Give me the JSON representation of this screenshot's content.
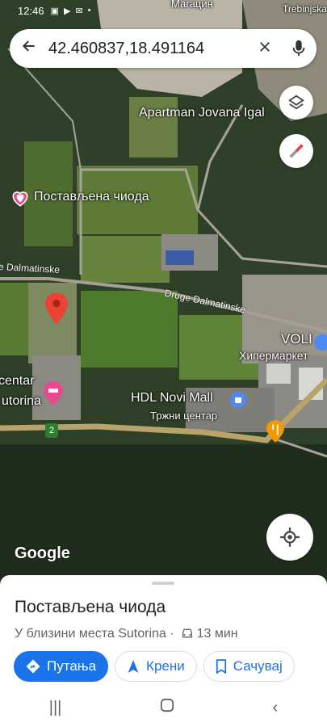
{
  "status_bar": {
    "time": "12:46"
  },
  "search": {
    "query": "42.460837,18.491164"
  },
  "map": {
    "labels": {
      "magacin": "Магацин",
      "trebinjska": "Trebinjska",
      "apartman": "Apartman Jovana Igal",
      "pin_label": "Постављена чиода",
      "road_druge_left": "e Dalmatinske",
      "road_druge_right": "Druge Dalmatinske",
      "voli": "VOLI",
      "voli_sub": "Хипермаркет",
      "hdl": "HDL Novi Mall",
      "hdl_sub": "Тржни центар",
      "centar_1": "centar",
      "centar_2": "utorina",
      "route_badge": "2"
    },
    "logo": "Google"
  },
  "place": {
    "title": "Постављена чиода",
    "subtitle": "У близини места Sutorina ·",
    "travel_time": "13 мин"
  },
  "actions": {
    "route": "Путања",
    "start": "Крени",
    "save": "Сачувај"
  },
  "colors": {
    "accent": "#1a73e8",
    "pin": "#ea4335"
  }
}
